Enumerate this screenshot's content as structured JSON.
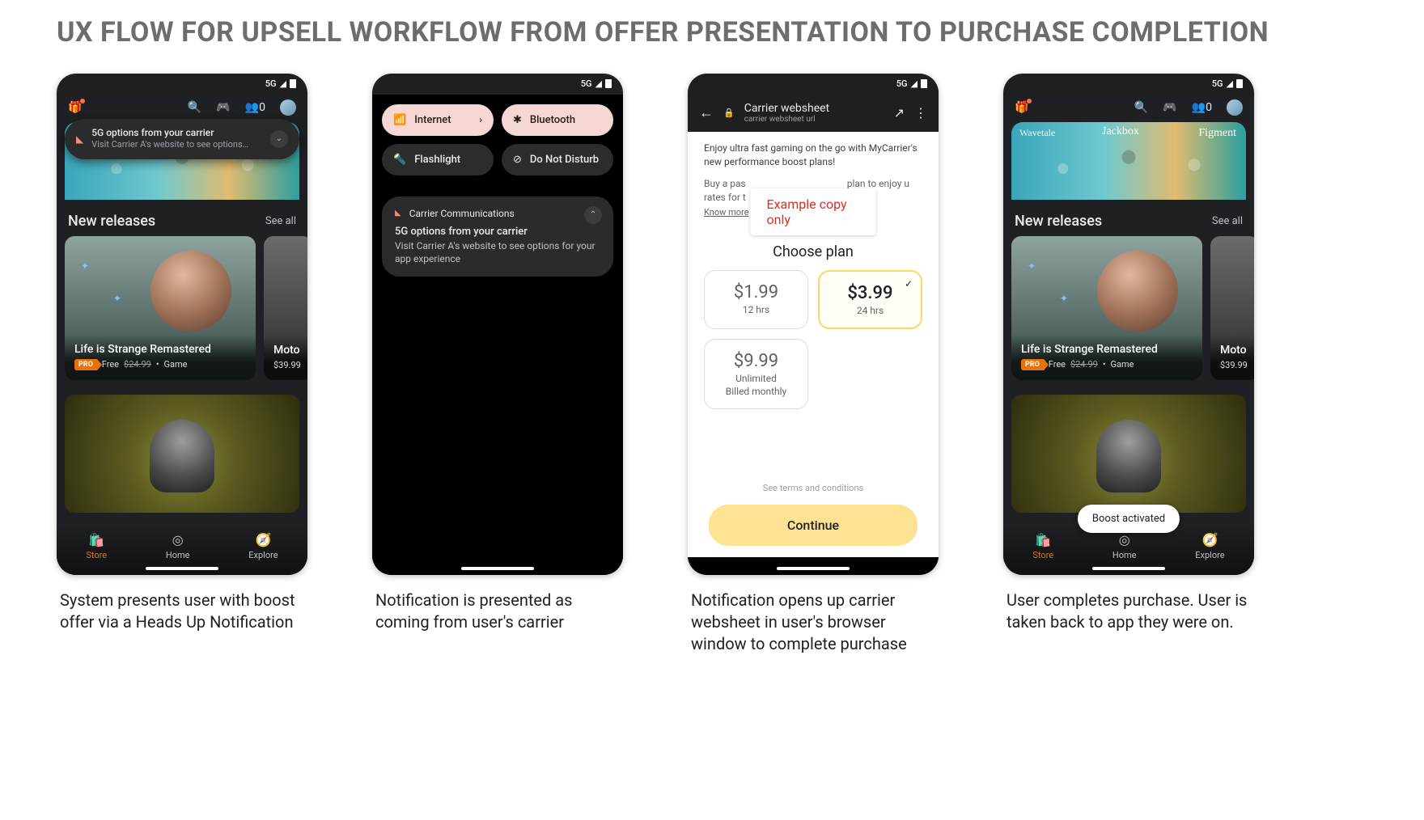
{
  "title": "UX FLOW FOR UPSELL WORKFLOW FROM OFFER PRESENTATION TO PURCHASE COMPLETION",
  "captions": [
    "System presents user with boost offer via a Heads Up Notification",
    "Notification is presented as coming from user's carrier",
    "Notification opens up carrier websheet in user's browser window to complete purchase",
    "User completes purchase. User is taken back to app they were on."
  ],
  "status": {
    "network": "5G"
  },
  "store": {
    "hero_labels": [
      "Wavetale",
      "Jackbox",
      "Figment"
    ],
    "section_title": "New releases",
    "see_all": "See all",
    "card1": {
      "title": "Life is Strange Remastered",
      "badge": "PRO",
      "free": "Free",
      "old_price": "$24.99",
      "category": "Game"
    },
    "card2": {
      "title_partial": "Moto",
      "price": "$39.99"
    },
    "nav": {
      "store": "Store",
      "home": "Home",
      "explore": "Explore"
    }
  },
  "hun": {
    "title": "5G options from your carrier",
    "subtitle": "Visit Carrier A's website to see options…"
  },
  "qs": {
    "internet": "Internet",
    "bluetooth": "Bluetooth",
    "flashlight": "Flashlight",
    "dnd": "Do Not Disturb"
  },
  "notif": {
    "source": "Carrier Communications",
    "title": "5G options from your carrier",
    "body": "Visit Carrier A's website to see options for your app experience"
  },
  "websheet": {
    "bar_title": "Carrier websheet",
    "bar_subtitle": "carrier websheet url",
    "intro": "Enjoy ultra fast gaming on the go with MyCarrier's new performance boost plans!",
    "para_left": "Buy a pas",
    "para_right": "plan to enjoy u rates for t",
    "know_more": "Know more",
    "example_label": "Example copy only",
    "choose": "Choose plan",
    "plans": [
      {
        "price": "$1.99",
        "duration": "12 hrs",
        "selected": false
      },
      {
        "price": "$3.99",
        "duration": "24 hrs",
        "selected": true
      },
      {
        "price": "$9.99",
        "duration": "Unlimited",
        "billing": "Billed monthly",
        "selected": false
      }
    ],
    "terms": "See terms and conditions",
    "continue": "Continue"
  },
  "toast": "Boost activated",
  "people_count": "0"
}
